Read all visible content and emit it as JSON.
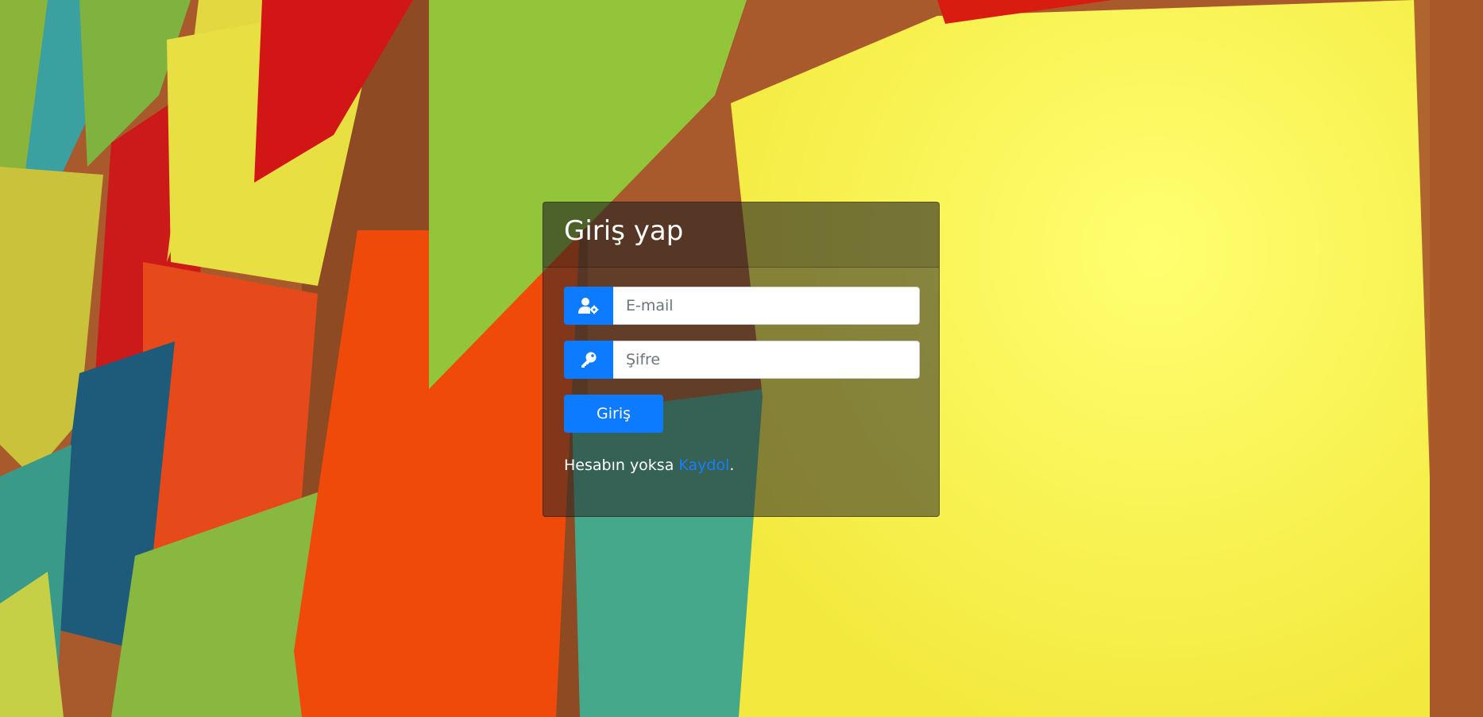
{
  "login": {
    "title": "Giriş yap",
    "email_placeholder": "E-mail",
    "password_placeholder": "Şifre",
    "submit_label": "Giriş",
    "register_prefix": "Hesabın yoksa ",
    "register_link": "Kaydol",
    "register_suffix": "."
  },
  "icons": {
    "email": "user-gear-icon",
    "password": "key-icon"
  },
  "colors": {
    "accent": "#0d7bff",
    "link": "#1a7dff",
    "card_overlay": "rgba(40,40,40,0.55)"
  }
}
